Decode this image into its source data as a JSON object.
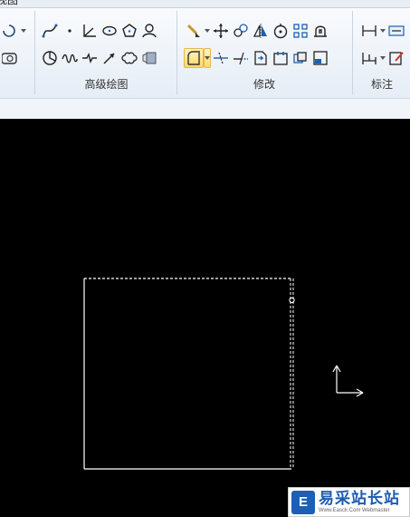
{
  "window": {
    "tab_label_partial": "视图"
  },
  "ribbon": {
    "groups": [
      {
        "label": ""
      },
      {
        "label": "高级绘图"
      },
      {
        "label": "修改"
      },
      {
        "label": "标注"
      }
    ],
    "draw_group_icons": [
      "spline-icon",
      "point-icon",
      "angle-line-icon",
      "ellipse-icon",
      "polygon-icon",
      "user-shape-icon",
      "sector-icon",
      "wave-line-icon",
      "break-line-icon",
      "arrow-icon",
      "cloud-line-icon",
      "hatch-icon"
    ],
    "modify_group_icons": [
      "brush-icon",
      "move-icon",
      "rotate-copy-icon",
      "mirror-icon",
      "circle-center-icon",
      "array-icon",
      "stretch-icon",
      "fillet-icon",
      "trim-icon",
      "extend-icon",
      "scale-icon",
      "align-icon",
      "explode-icon",
      "block-icon"
    ]
  },
  "canvas": {
    "background": "#000000",
    "rectangle_color": "#ffffff",
    "ucs_arrow": "coordinate-axis-icon"
  },
  "watermark": {
    "title": "易采站长站",
    "subtitle": "Www.Easck.Com Webmaster",
    "logo_letter": "E"
  }
}
